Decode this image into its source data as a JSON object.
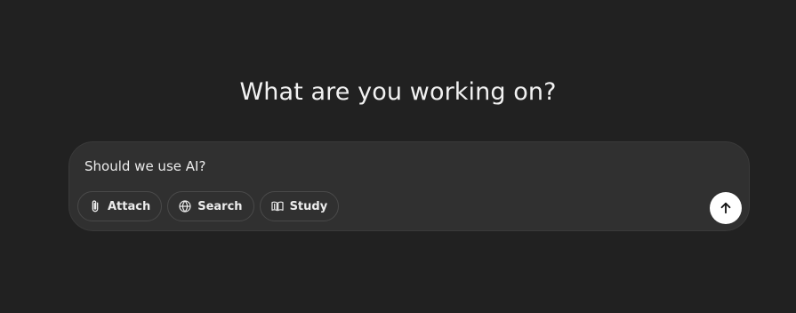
{
  "main": {
    "heading": "What are you working on?"
  },
  "composer": {
    "input_value": "Should we use AI?",
    "tools": [
      {
        "label": "Attach",
        "icon": "paperclip-icon"
      },
      {
        "label": "Search",
        "icon": "globe-icon"
      },
      {
        "label": "Study",
        "icon": "book-icon"
      }
    ],
    "send_icon": "arrow-up-icon"
  },
  "colors": {
    "background": "#212121",
    "composer_bg": "#303030",
    "send_button_bg": "#ffffff"
  }
}
